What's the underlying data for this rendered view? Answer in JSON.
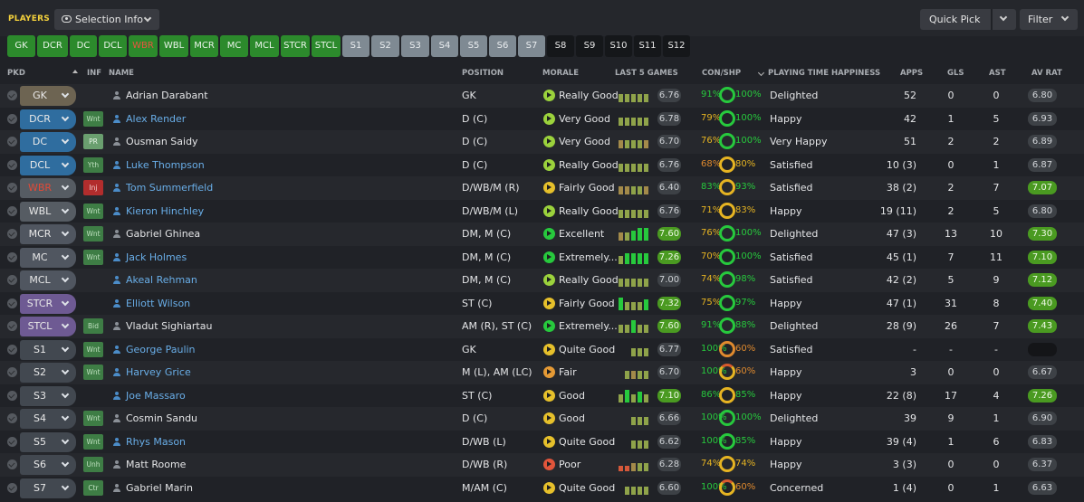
{
  "header": {
    "title": "PLAYERS",
    "selection_info": "Selection Info",
    "quick_pick": "Quick Pick",
    "filter": "Filter"
  },
  "position_buttons": [
    {
      "label": "GK",
      "style": "g"
    },
    {
      "label": "DCR",
      "style": "g"
    },
    {
      "label": "DC",
      "style": "g"
    },
    {
      "label": "DCL",
      "style": "g"
    },
    {
      "label": "WBR",
      "style": "r"
    },
    {
      "label": "WBL",
      "style": "g"
    },
    {
      "label": "MCR",
      "style": "g"
    },
    {
      "label": "MC",
      "style": "g"
    },
    {
      "label": "MCL",
      "style": "g"
    },
    {
      "label": "STCR",
      "style": "g"
    },
    {
      "label": "STCL",
      "style": "g"
    },
    {
      "label": "S1",
      "style": "s"
    },
    {
      "label": "S2",
      "style": "s"
    },
    {
      "label": "S3",
      "style": "s"
    },
    {
      "label": "S4",
      "style": "s"
    },
    {
      "label": "S5",
      "style": "s"
    },
    {
      "label": "S6",
      "style": "s"
    },
    {
      "label": "S7",
      "style": "s"
    },
    {
      "label": "S8",
      "style": "d"
    },
    {
      "label": "S9",
      "style": "d"
    },
    {
      "label": "S10",
      "style": "d"
    },
    {
      "label": "S11",
      "style": "d"
    },
    {
      "label": "S12",
      "style": "d"
    }
  ],
  "columns": {
    "pkd": "PKD",
    "inf": "INF",
    "name": "NAME",
    "position": "POSITION",
    "morale": "MORALE",
    "last5": "LAST 5 GAMES",
    "conshp": "CON/SHP",
    "pth": "PLAYING TIME HAPPINESS",
    "apps": "APPS",
    "gls": "GLS",
    "ast": "AST",
    "avrat": "AV RAT"
  },
  "colors": {
    "green_button": "#2c8a2c",
    "sub_button": "#7f8a93",
    "empty_button": "#15171a",
    "accent_yellow": "#f4d13c",
    "link_blue": "#69aee8",
    "rating_green": "#4a9a21"
  },
  "players": [
    {
      "slot": "GK",
      "slot_style": "gk",
      "inf": "",
      "inf_style": "",
      "name": "Adrian Darabant",
      "link": false,
      "position": "GK",
      "morale": "Really Good",
      "morale_color": "#9bd23c",
      "bars": [
        3,
        3,
        3,
        3,
        3
      ],
      "bar_colors": [
        "#8fa34a",
        "#8fa34a",
        "#8fa34a",
        "#8fa34a",
        "#8fa34a"
      ],
      "last5": "6.76",
      "last5_hi": false,
      "con": "91%",
      "con_color": "#27c93d",
      "shp": "100%",
      "shp_color": "#27c93d",
      "ring": "g",
      "pth": "Delighted",
      "apps": "52",
      "gls": "0",
      "ast": "0",
      "avrat": "6.80",
      "avrat_hi": false
    },
    {
      "slot": "DCR",
      "slot_style": "def",
      "inf": "Wnt",
      "inf_style": "green",
      "name": "Alex Render",
      "link": true,
      "position": "D (C)",
      "morale": "Very Good",
      "morale_color": "#9bd23c",
      "bars": [
        3,
        3,
        3,
        3,
        3
      ],
      "bar_colors": [
        "#8fa34a",
        "#8fa34a",
        "#8fa34a",
        "#8fa34a",
        "#8fa34a"
      ],
      "last5": "6.78",
      "last5_hi": false,
      "con": "79%",
      "con_color": "#e6b422",
      "shp": "100%",
      "shp_color": "#27c93d",
      "ring": "g",
      "pth": "Happy",
      "apps": "42",
      "gls": "1",
      "ast": "5",
      "avrat": "6.93",
      "avrat_hi": false
    },
    {
      "slot": "DC",
      "slot_style": "def",
      "inf": "PR",
      "inf_style": "pr",
      "name": "Ousman Saidy",
      "link": false,
      "position": "D (C)",
      "morale": "Very Good",
      "morale_color": "#9bd23c",
      "bars": [
        3,
        3,
        3,
        3,
        3
      ],
      "bar_colors": [
        "#a38a4a",
        "#8fa34a",
        "#8fa34a",
        "#8fa34a",
        "#a38a4a"
      ],
      "last5": "6.70",
      "last5_hi": false,
      "con": "76%",
      "con_color": "#e6b422",
      "shp": "100%",
      "shp_color": "#27c93d",
      "ring": "g",
      "pth": "Very Happy",
      "apps": "51",
      "gls": "2",
      "ast": "2",
      "avrat": "6.89",
      "avrat_hi": false
    },
    {
      "slot": "DCL",
      "slot_style": "def",
      "inf": "Yth",
      "inf_style": "green",
      "name": "Luke Thompson",
      "link": true,
      "position": "D (C)",
      "morale": "Really Good",
      "morale_color": "#9bd23c",
      "bars": [
        3,
        3,
        3,
        3,
        3
      ],
      "bar_colors": [
        "#8fa34a",
        "#8fa34a",
        "#8fa34a",
        "#8fa34a",
        "#8fa34a"
      ],
      "last5": "6.76",
      "last5_hi": false,
      "con": "68%",
      "con_color": "#e08a2e",
      "shp": "80%",
      "shp_color": "#e6b422",
      "ring": "y",
      "pth": "Satisfied",
      "apps": "10 (3)",
      "gls": "0",
      "ast": "1",
      "avrat": "6.87",
      "avrat_hi": false
    },
    {
      "slot": "WBR",
      "slot_style": "wbr",
      "inf": "Inj",
      "inf_style": "inj",
      "name": "Tom Summerfield",
      "link": true,
      "position": "D/WB/M (R)",
      "morale": "Fairly Good",
      "morale_color": "#e6c02b",
      "bars": [
        3,
        3,
        3,
        3,
        3
      ],
      "bar_colors": [
        "#a38a4a",
        "#a38a4a",
        "#8fa34a",
        "#8fa34a",
        "#a38a4a"
      ],
      "last5": "6.40",
      "last5_hi": false,
      "con": "83%",
      "con_color": "#27c93d",
      "shp": "93%",
      "shp_color": "#27c93d",
      "ring": "y",
      "pth": "Satisfied",
      "apps": "38 (2)",
      "gls": "2",
      "ast": "7",
      "avrat": "7.07",
      "avrat_hi": true
    },
    {
      "slot": "WBL",
      "slot_style": "wb",
      "inf": "Wnt",
      "inf_style": "green",
      "name": "Kieron Hinchley",
      "link": true,
      "position": "D/WB/M (L)",
      "morale": "Really Good",
      "morale_color": "#9bd23c",
      "bars": [
        3,
        3,
        3,
        3,
        3
      ],
      "bar_colors": [
        "#8fa34a",
        "#8fa34a",
        "#8fa34a",
        "#8fa34a",
        "#8fa34a"
      ],
      "last5": "6.76",
      "last5_hi": false,
      "con": "71%",
      "con_color": "#e6b422",
      "shp": "83%",
      "shp_color": "#e6b422",
      "ring": "y",
      "pth": "Happy",
      "apps": "19 (11)",
      "gls": "2",
      "ast": "5",
      "avrat": "6.80",
      "avrat_hi": false
    },
    {
      "slot": "MCR",
      "slot_style": "mid",
      "inf": "Wnt",
      "inf_style": "green",
      "name": "Gabriel Ghinea",
      "link": false,
      "position": "DM, M (C)",
      "morale": "Excellent",
      "morale_color": "#27c93d",
      "bars": [
        3,
        3,
        4,
        5,
        5
      ],
      "bar_colors": [
        "#a38a4a",
        "#8fa34a",
        "#27c93d",
        "#27c93d",
        "#27c93d"
      ],
      "last5": "7.60",
      "last5_hi": true,
      "con": "76%",
      "con_color": "#e6b422",
      "shp": "100%",
      "shp_color": "#27c93d",
      "ring": "g",
      "pth": "Delighted",
      "apps": "47 (3)",
      "gls": "13",
      "ast": "10",
      "avrat": "7.30",
      "avrat_hi": true
    },
    {
      "slot": "MC",
      "slot_style": "mid",
      "inf": "Wnt",
      "inf_style": "green",
      "name": "Jack Holmes",
      "link": true,
      "position": "DM, M (C)",
      "morale": "Extremely...",
      "morale_color": "#27c93d",
      "bars": [
        3,
        4,
        4,
        4,
        4
      ],
      "bar_colors": [
        "#8fa34a",
        "#27c93d",
        "#27c93d",
        "#27c93d",
        "#27c93d"
      ],
      "last5": "7.26",
      "last5_hi": true,
      "con": "70%",
      "con_color": "#e6b422",
      "shp": "100%",
      "shp_color": "#27c93d",
      "ring": "g",
      "pth": "Satisfied",
      "apps": "45 (1)",
      "gls": "7",
      "ast": "11",
      "avrat": "7.10",
      "avrat_hi": true
    },
    {
      "slot": "MCL",
      "slot_style": "mid",
      "inf": "",
      "inf_style": "",
      "name": "Akeal Rehman",
      "link": true,
      "position": "DM, M (C)",
      "morale": "Really Good",
      "morale_color": "#9bd23c",
      "bars": [
        3,
        3,
        3,
        3,
        3
      ],
      "bar_colors": [
        "#8fa34a",
        "#8fa34a",
        "#8fa34a",
        "#8fa34a",
        "#8fa34a"
      ],
      "last5": "7.00",
      "last5_hi": false,
      "con": "74%",
      "con_color": "#e6b422",
      "shp": "98%",
      "shp_color": "#27c93d",
      "ring": "g",
      "pth": "Satisfied",
      "apps": "42 (2)",
      "gls": "5",
      "ast": "9",
      "avrat": "7.12",
      "avrat_hi": true
    },
    {
      "slot": "STCR",
      "slot_style": "st",
      "inf": "",
      "inf_style": "",
      "name": "Elliott Wilson",
      "link": true,
      "position": "ST (C)",
      "morale": "Fairly Good",
      "morale_color": "#e6c02b",
      "bars": [
        5,
        3,
        3,
        3,
        4
      ],
      "bar_colors": [
        "#27c93d",
        "#8fa34a",
        "#8fa34a",
        "#8fa34a",
        "#27c93d"
      ],
      "last5": "7.32",
      "last5_hi": true,
      "con": "75%",
      "con_color": "#e6b422",
      "shp": "97%",
      "shp_color": "#27c93d",
      "ring": "g",
      "pth": "Happy",
      "apps": "47 (1)",
      "gls": "31",
      "ast": "8",
      "avrat": "7.40",
      "avrat_hi": true
    },
    {
      "slot": "STCL",
      "slot_style": "st",
      "inf": "Bid",
      "inf_style": "green",
      "name": "Vladut Sighiartau",
      "link": false,
      "position": "AM (R), ST (C)",
      "morale": "Extremely...",
      "morale_color": "#27c93d",
      "bars": [
        3,
        3,
        5,
        3,
        3
      ],
      "bar_colors": [
        "#8fa34a",
        "#8fa34a",
        "#27c93d",
        "#8fa34a",
        "#8fa34a"
      ],
      "last5": "7.60",
      "last5_hi": true,
      "con": "91%",
      "con_color": "#27c93d",
      "shp": "88%",
      "shp_color": "#27c93d",
      "ring": "g",
      "pth": "Delighted",
      "apps": "28 (9)",
      "gls": "26",
      "ast": "7",
      "avrat": "7.43",
      "avrat_hi": true
    },
    {
      "slot": "S1",
      "slot_style": "sub",
      "inf": "Wnt",
      "inf_style": "green",
      "name": "George Paulin",
      "link": true,
      "position": "GK",
      "morale": "Quite Good",
      "morale_color": "#e6c02b",
      "bars": [
        0,
        0,
        3,
        3,
        3
      ],
      "bar_colors": [
        "#8fa34a",
        "#8fa34a",
        "#8fa34a",
        "#8fa34a",
        "#8fa34a"
      ],
      "last5": "6.77",
      "last5_hi": false,
      "con": "100%",
      "con_color": "#27c93d",
      "shp": "60%",
      "shp_color": "#e08a2e",
      "ring": "o",
      "pth": "Satisfied",
      "apps": "-",
      "gls": "-",
      "ast": "-",
      "avrat": "",
      "avrat_hi": false
    },
    {
      "slot": "S2",
      "slot_style": "sub",
      "inf": "Wnt",
      "inf_style": "green",
      "name": "Harvey Grice",
      "link": true,
      "position": "M (L), AM (LC)",
      "morale": "Fair",
      "morale_color": "#e59a35",
      "bars": [
        0,
        3,
        3,
        3,
        3
      ],
      "bar_colors": [
        "#8fa34a",
        "#8fa34a",
        "#a38a4a",
        "#8fa34a",
        "#8fa34a"
      ],
      "last5": "6.70",
      "last5_hi": false,
      "con": "100%",
      "con_color": "#27c93d",
      "shp": "60%",
      "shp_color": "#e08a2e",
      "ring": "on",
      "pth": "Happy",
      "apps": "3",
      "gls": "0",
      "ast": "0",
      "avrat": "6.67",
      "avrat_hi": false
    },
    {
      "slot": "S3",
      "slot_style": "sub",
      "inf": "",
      "inf_style": "",
      "name": "Joe Massaro",
      "link": true,
      "position": "ST (C)",
      "morale": "Good",
      "morale_color": "#e6c02b",
      "bars": [
        3,
        5,
        3,
        4,
        3
      ],
      "bar_colors": [
        "#8fa34a",
        "#27c93d",
        "#8fa34a",
        "#27c93d",
        "#8fa34a"
      ],
      "last5": "7.10",
      "last5_hi": true,
      "con": "86%",
      "con_color": "#27c93d",
      "shp": "85%",
      "shp_color": "#27c93d",
      "ring": "y",
      "pth": "Happy",
      "apps": "22 (8)",
      "gls": "17",
      "ast": "4",
      "avrat": "7.26",
      "avrat_hi": true
    },
    {
      "slot": "S4",
      "slot_style": "sub",
      "inf": "Wnt",
      "inf_style": "green",
      "name": "Cosmin Sandu",
      "link": false,
      "position": "D (C)",
      "morale": "Good",
      "morale_color": "#e6c02b",
      "bars": [
        0,
        0,
        3,
        3,
        3
      ],
      "bar_colors": [
        "#8fa34a",
        "#8fa34a",
        "#8fa34a",
        "#8fa34a",
        "#8fa34a"
      ],
      "last5": "6.66",
      "last5_hi": false,
      "con": "100%",
      "con_color": "#27c93d",
      "shp": "100%",
      "shp_color": "#27c93d",
      "ring": "g",
      "pth": "Delighted",
      "apps": "39",
      "gls": "9",
      "ast": "1",
      "avrat": "6.90",
      "avrat_hi": false
    },
    {
      "slot": "S5",
      "slot_style": "sub",
      "inf": "Wnt",
      "inf_style": "green",
      "name": "Rhys Mason",
      "link": true,
      "position": "D/WB (L)",
      "morale": "Quite Good",
      "morale_color": "#e6c02b",
      "bars": [
        0,
        0,
        3,
        3,
        3
      ],
      "bar_colors": [
        "#8fa34a",
        "#8fa34a",
        "#8fa34a",
        "#8fa34a",
        "#8fa34a"
      ],
      "last5": "6.62",
      "last5_hi": false,
      "con": "100%",
      "con_color": "#27c93d",
      "shp": "85%",
      "shp_color": "#27c93d",
      "ring": "g",
      "pth": "Happy",
      "apps": "39 (4)",
      "gls": "1",
      "ast": "6",
      "avrat": "6.83",
      "avrat_hi": false
    },
    {
      "slot": "S6",
      "slot_style": "sub",
      "inf": "Unh",
      "inf_style": "green",
      "name": "Matt Roome",
      "link": false,
      "position": "D/WB (R)",
      "morale": "Poor",
      "morale_color": "#e2553b",
      "bars": [
        2,
        2,
        3,
        3,
        3
      ],
      "bar_colors": [
        "#d5583a",
        "#d5583a",
        "#a38a4a",
        "#8fa34a",
        "#8fa34a"
      ],
      "last5": "6.28",
      "last5_hi": false,
      "con": "74%",
      "con_color": "#e6b422",
      "shp": "74%",
      "shp_color": "#e6b422",
      "ring": "y",
      "pth": "Happy",
      "apps": "3 (3)",
      "gls": "0",
      "ast": "0",
      "avrat": "6.37",
      "avrat_hi": false
    },
    {
      "slot": "S7",
      "slot_style": "sub",
      "inf": "Ctr",
      "inf_style": "green",
      "name": "Gabriel Marin",
      "link": false,
      "position": "M/AM (C)",
      "morale": "Quite Good",
      "morale_color": "#e6c02b",
      "bars": [
        0,
        3,
        3,
        3,
        3
      ],
      "bar_colors": [
        "#8fa34a",
        "#8fa34a",
        "#8fa34a",
        "#8fa34a",
        "#8fa34a"
      ],
      "last5": "6.60",
      "last5_hi": false,
      "con": "100%",
      "con_color": "#27c93d",
      "shp": "60%",
      "shp_color": "#e08a2e",
      "ring": "on",
      "pth": "Concerned",
      "apps": "1 (4)",
      "gls": "0",
      "ast": "1",
      "avrat": "6.63",
      "avrat_hi": false
    }
  ]
}
